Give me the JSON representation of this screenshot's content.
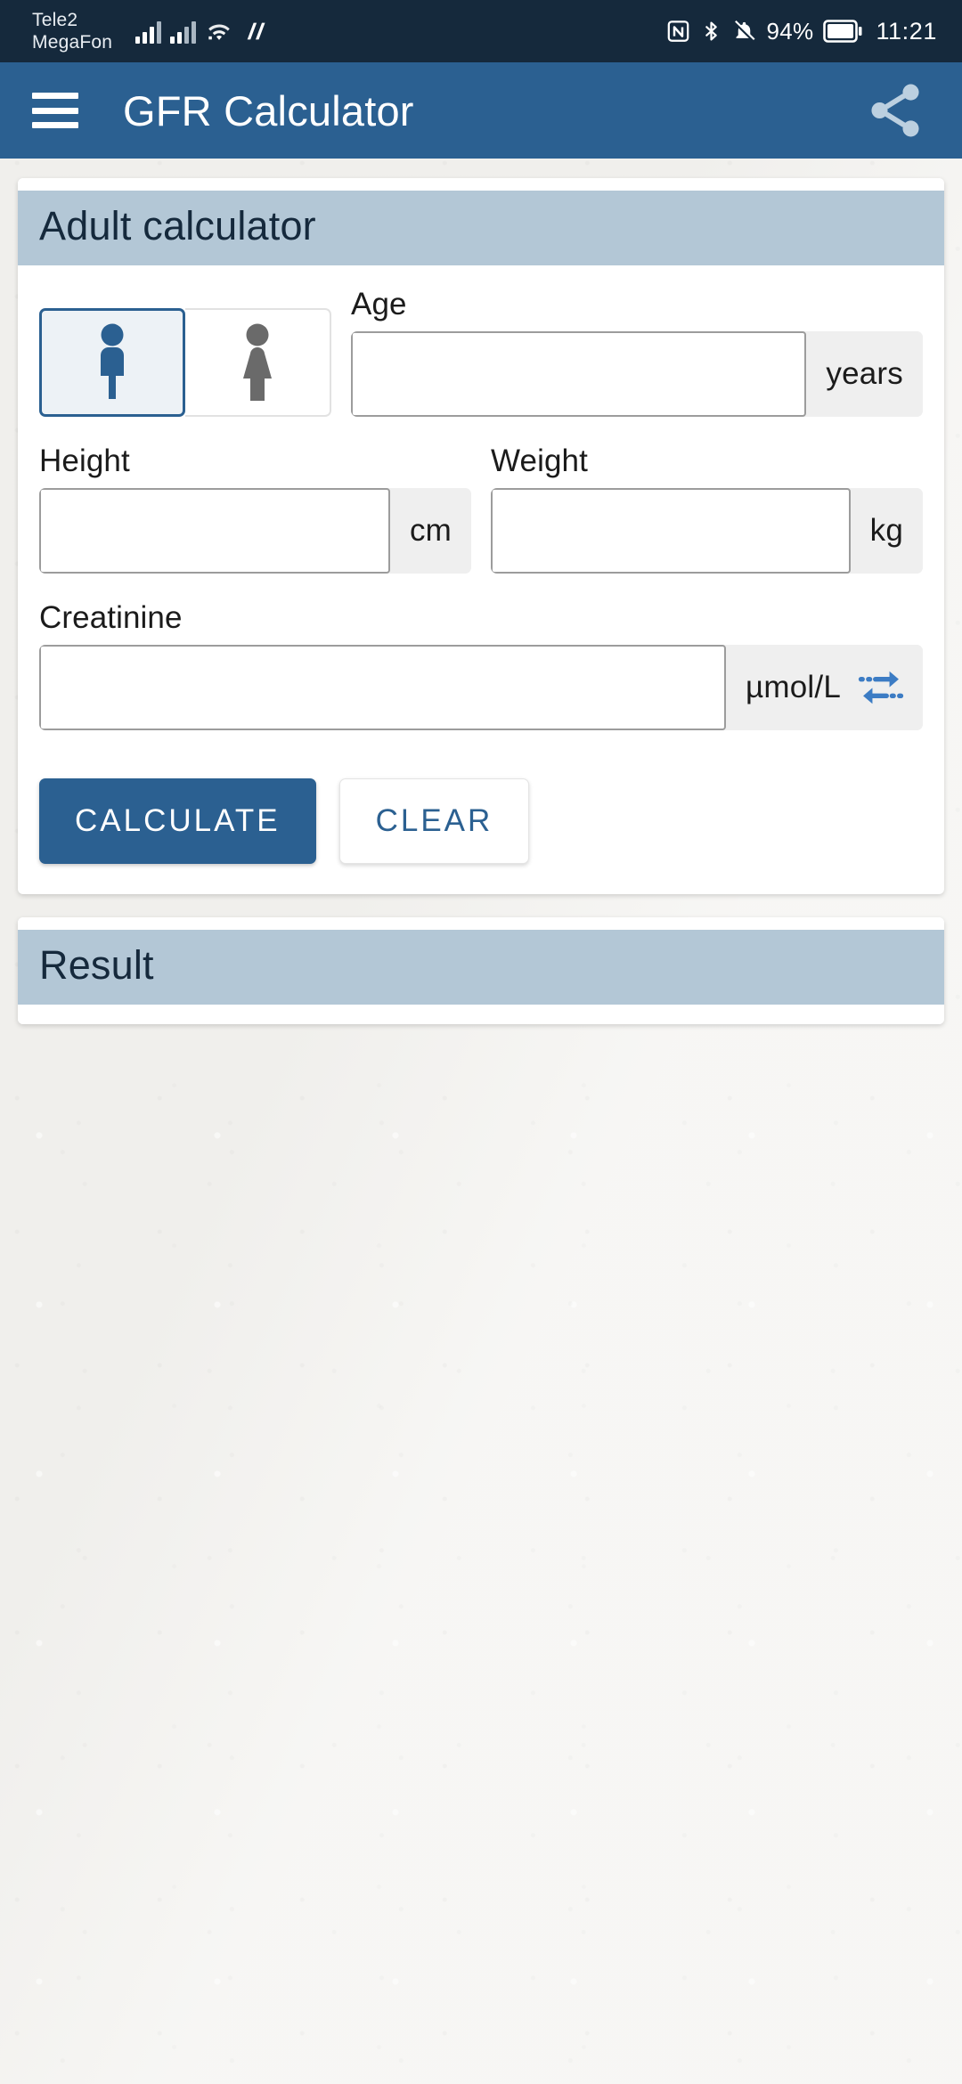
{
  "status_bar": {
    "carrier_line1": "Tele2",
    "carrier_line2": "MegaFon",
    "battery_percent": "94%",
    "time": "11:21",
    "icons": [
      "signal-bars-icon",
      "signal-bars-icon",
      "wifi-icon",
      "data-transfer-icon",
      "nfc-icon",
      "bluetooth-icon",
      "bell-muted-icon",
      "battery-icon"
    ]
  },
  "app_bar": {
    "title": "GFR Calculator",
    "menu_icon": "hamburger-menu-icon",
    "share_icon": "share-icon"
  },
  "calculator_card": {
    "title": "Adult calculator",
    "gender": {
      "male_icon": "male-figure-icon",
      "female_icon": "female-figure-icon",
      "selected": "male"
    },
    "fields": {
      "age": {
        "label": "Age",
        "value": "",
        "placeholder": "",
        "unit": "years"
      },
      "height": {
        "label": "Height",
        "value": "",
        "placeholder": "",
        "unit": "cm"
      },
      "weight": {
        "label": "Weight",
        "value": "",
        "placeholder": "",
        "unit": "kg"
      },
      "creatinine": {
        "label": "Creatinine",
        "value": "",
        "placeholder": "",
        "unit": "µmol/L",
        "swap_icon": "swap-units-icon"
      }
    },
    "buttons": {
      "calculate": "CALCULATE",
      "clear": "CLEAR"
    }
  },
  "result_card": {
    "title": "Result"
  },
  "colors": {
    "status_bar": "#15293c",
    "app_bar": "#2b6091",
    "card_header": "#b3c7d6",
    "accent": "#2b6091",
    "page_background": "#f3f2ef",
    "swap_icon": "#3c7cc4"
  }
}
